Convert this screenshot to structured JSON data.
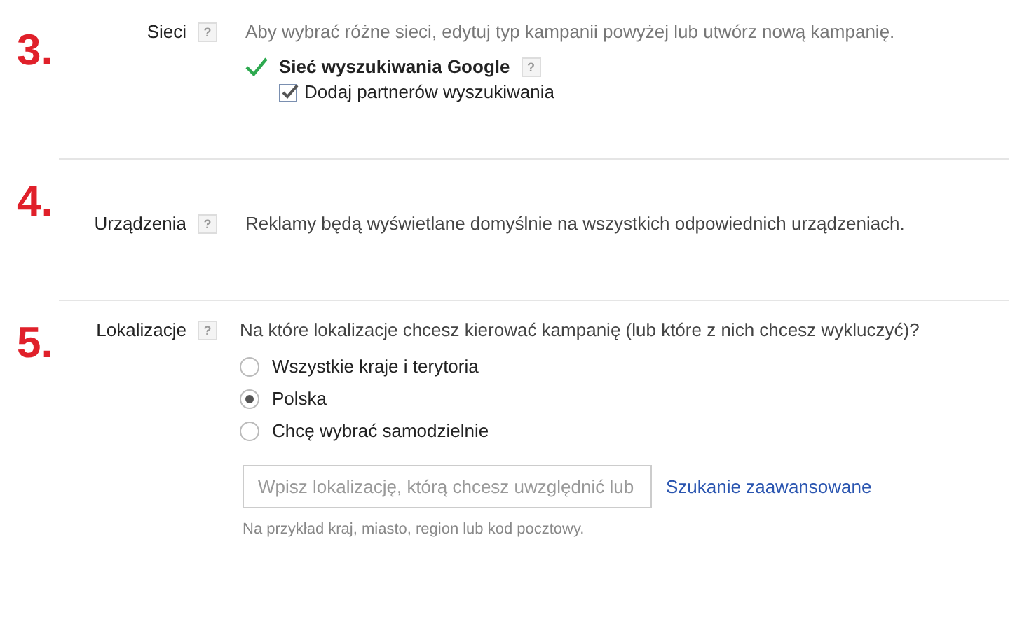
{
  "sections": [
    {
      "kind": "networks",
      "number": "3.",
      "label": "Sieci",
      "help": "?",
      "description": "Aby wybrać różne sieci, edytuj typ kampanii powyżej lub utwórz nową kampanię.",
      "network": {
        "name": "Sieć wyszukiwania Google",
        "help": "?",
        "checked": true
      },
      "partners": {
        "label": "Dodaj partnerów wyszukiwania",
        "checked": true
      }
    },
    {
      "kind": "devices",
      "number": "4.",
      "label": "Urządzenia",
      "help": "?",
      "description": "Reklamy będą wyświetlane domyślnie na wszystkich odpowiednich urządzeniach."
    },
    {
      "kind": "locations",
      "number": "5.",
      "label": "Lokalizacje",
      "help": "?",
      "description": "Na które lokalizacje chcesz kierować kampanię (lub które z nich chcesz wykluczyć)?",
      "options": [
        {
          "label": "Wszystkie kraje i terytoria",
          "selected": false
        },
        {
          "label": "Polska",
          "selected": true
        },
        {
          "label": "Chcę wybrać samodzielnie",
          "selected": false
        }
      ],
      "search": {
        "placeholder": "Wpisz lokalizację, którą chcesz uwzględnić lub"
      },
      "advanced_link": "Szukanie zaawansowane",
      "hint": "Na przykład kraj, miasto, region lub kod pocztowy."
    }
  ]
}
